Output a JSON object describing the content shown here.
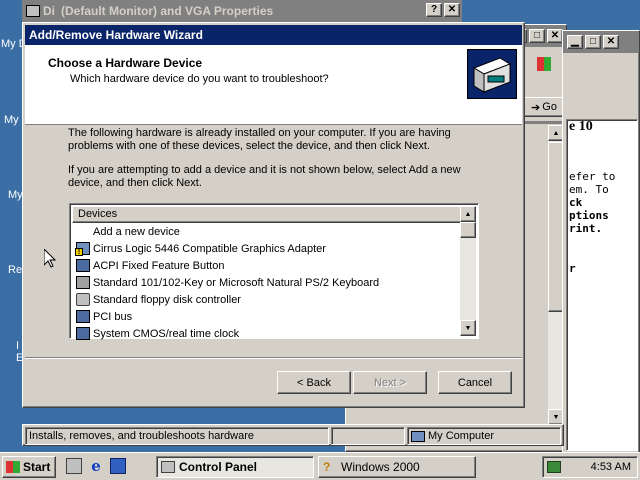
{
  "desktop": {
    "labels": [
      "My D",
      "My",
      "My",
      "Re",
      "I",
      "E"
    ]
  },
  "display_props": {
    "title": "(Default Monitor) and VGA Properties",
    "prefix": "Di"
  },
  "explorer": {
    "go_label": "Go",
    "lines": [
      "e 10",
      "",
      "efer to",
      "em. To",
      "ck",
      "ptions",
      "rint.",
      "",
      "",
      "r"
    ]
  },
  "wizard": {
    "title": "Add/Remove Hardware Wizard",
    "heading": "Choose a Hardware Device",
    "subheading": "Which hardware device do you want to troubleshoot?",
    "para1": "The following hardware is already installed on your computer. If you are having problems with one of these devices, select the device, and then click Next.",
    "para2": "If you are attempting to add a device and it is not shown below, select Add a new device, and then click Next.",
    "list_header": "Devices",
    "devices": [
      {
        "label": "Add a new device",
        "icon": "none"
      },
      {
        "label": "Cirrus Logic 5446 Compatible Graphics Adapter",
        "icon": "warning-display-icon"
      },
      {
        "label": "ACPI Fixed Feature Button",
        "icon": "computer-icon"
      },
      {
        "label": "Standard 101/102-Key or Microsoft Natural PS/2 Keyboard",
        "icon": "keyboard-icon"
      },
      {
        "label": "Standard floppy disk controller",
        "icon": "floppy-icon"
      },
      {
        "label": "PCI bus",
        "icon": "computer-icon"
      },
      {
        "label": "System CMOS/real time clock",
        "icon": "computer-icon"
      }
    ],
    "back_label": "< Back",
    "next_label": "Next >",
    "cancel_label": "Cancel"
  },
  "status": {
    "text": "Installs, removes, and troubleshoots hardware",
    "location": "My Computer"
  },
  "taskbar": {
    "start_label": "Start",
    "tasks": [
      "Control Panel",
      "Windows 2000"
    ],
    "clock": "4:53 AM"
  },
  "colors": {
    "desktop": "#3a6ea5",
    "active_title": "#0a246a",
    "inactive_title": "#808080",
    "face": "#d4d0c8"
  }
}
